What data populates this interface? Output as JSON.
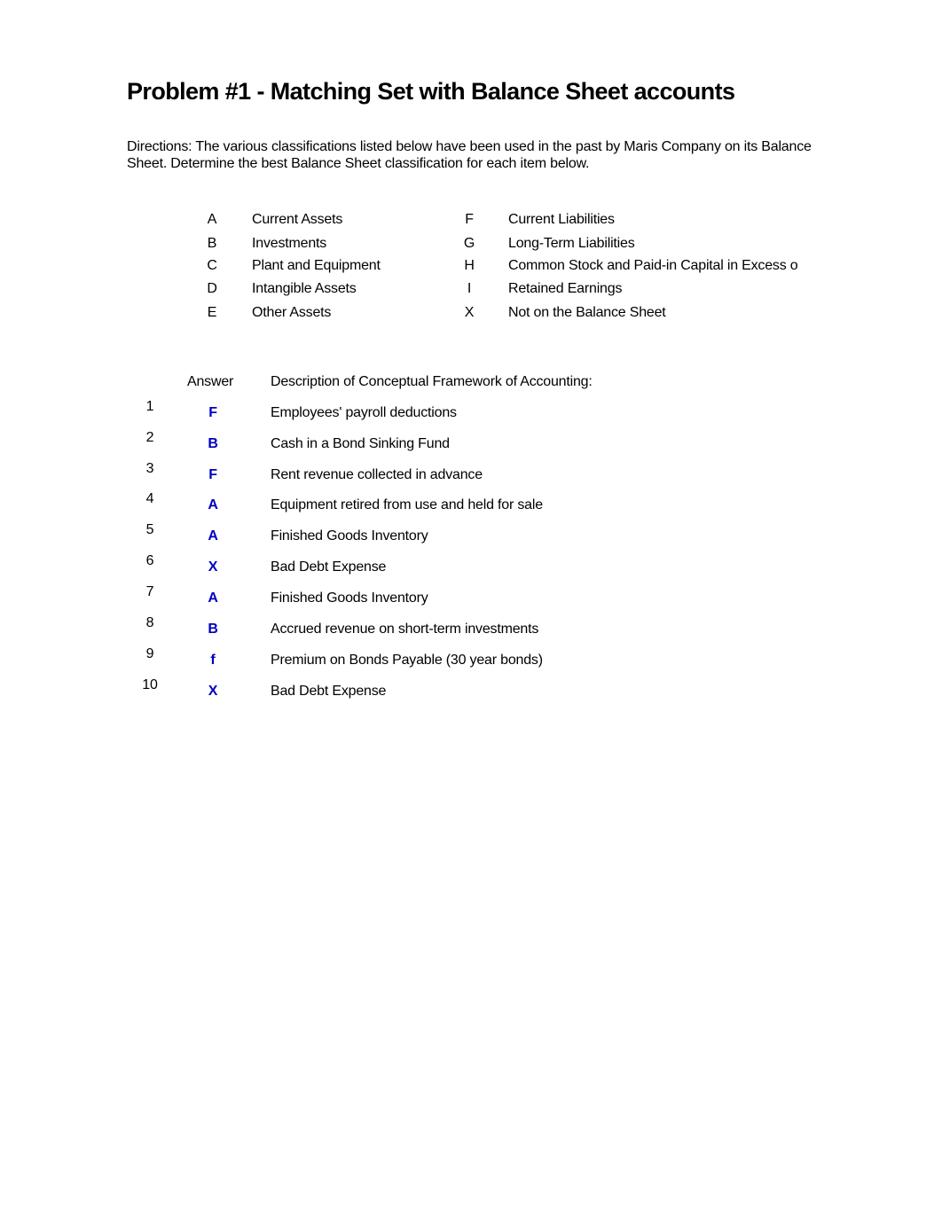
{
  "title": "Problem #1 - Matching Set with Balance Sheet accounts",
  "directions": "Directions:  The various classifications listed below have been used in the past by Maris Company on its Balance Sheet. Determine the best Balance Sheet classification for each item below.",
  "classifications_left": [
    {
      "code": "A",
      "label": "Current Assets"
    },
    {
      "code": "B",
      "label": "Investments"
    },
    {
      "code": "C",
      "label": "Plant and Equipment"
    },
    {
      "code": "D",
      "label": "Intangible Assets"
    },
    {
      "code": "E",
      "label": "Other Assets"
    }
  ],
  "classifications_right": [
    {
      "code": "F",
      "label": "Current Liabilities"
    },
    {
      "code": "G",
      "label": "Long-Term Liabilities"
    },
    {
      "code": "H",
      "label": "Common Stock and Paid-in Capital in Excess o"
    },
    {
      "code": "I",
      "label": "Retained Earnings"
    },
    {
      "code": "X",
      "label": "Not on the Balance Sheet"
    }
  ],
  "table": {
    "answer_header": "Answer",
    "description_header": "Description of Conceptual Framework of Accounting:",
    "answer_color": "#0000c0",
    "rows": [
      {
        "num": "1",
        "answer": "F",
        "description": "Employees' payroll deductions"
      },
      {
        "num": "2",
        "answer": "B",
        "description": "Cash in a Bond Sinking Fund"
      },
      {
        "num": "3",
        "answer": "F",
        "description": "Rent revenue collected in advance"
      },
      {
        "num": "4",
        "answer": "A",
        "description": "Equipment retired from use and held for sale"
      },
      {
        "num": "5",
        "answer": "A",
        "description": "Finished Goods Inventory"
      },
      {
        "num": "6",
        "answer": "X",
        "description": "Bad Debt Expense"
      },
      {
        "num": "7",
        "answer": "A",
        "description": "Finished Goods Inventory"
      },
      {
        "num": "8",
        "answer": "B",
        "description": "Accrued revenue on short-term investments"
      },
      {
        "num": "9",
        "answer": "f",
        "description": "Premium on Bonds Payable (30 year bonds)"
      },
      {
        "num": "10",
        "answer": "X",
        "description": "Bad Debt Expense"
      }
    ]
  }
}
